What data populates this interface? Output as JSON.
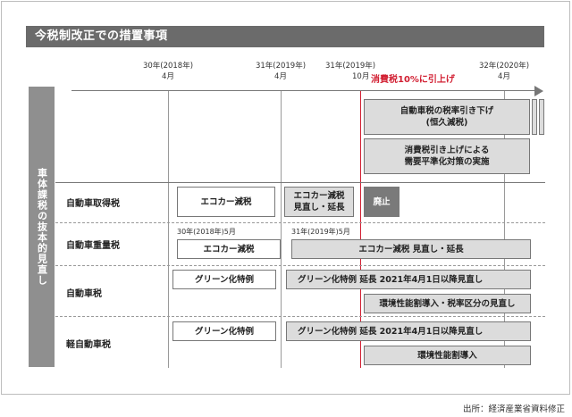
{
  "title": "今税制改正での措置事項",
  "side_label": "車体課税の抜本的見直し",
  "timeline": {
    "h1_year": "30年(2018年)",
    "h1_month": "4月",
    "h2_year": "31年(2019年)",
    "h2_month": "4月",
    "h3_year": "31年(2019年)",
    "h3_month": "10月",
    "h3_label": "消費税10%に引上げ",
    "h4_year": "32年(2020年)",
    "h4_month": "4月"
  },
  "top_boxes": {
    "auto_tax_cut": "自動車税の税率引き下げ\n(恒久減税)",
    "demand_measures": "消費税引き上げによる\n需要平準化対策の実施"
  },
  "rows": {
    "acquisition": {
      "label": "自動車取得税",
      "eco": "エコカー減税",
      "eco_review": "エコカー減税\n見直し・延長",
      "abolish": "廃止"
    },
    "weight": {
      "label": "自動車重量税",
      "sub1": "30年(2018年)5月",
      "sub2": "31年(2019年)5月",
      "eco": "エコカー減税",
      "eco_review": "エコカー減税  見直し・延長"
    },
    "auto": {
      "label": "自動車税",
      "green": "グリーン化特例",
      "green_ext": "グリーン化特例  延長  2021年4月1日以降見直し",
      "env": "環境性能割導入・税率区分の見直し"
    },
    "light": {
      "label": "軽自動車税",
      "green": "グリーン化特例",
      "green_ext": "グリーン化特例  延長  2021年4月1日以降見直し",
      "env": "環境性能割導入"
    }
  },
  "source": "出所：経済産業省資料修正",
  "colors": {
    "accent_red": "#d21f32",
    "title_bg": "#6b6b6b",
    "box_gray": "#dcdcdc",
    "dark_box": "#7a7a7a"
  }
}
